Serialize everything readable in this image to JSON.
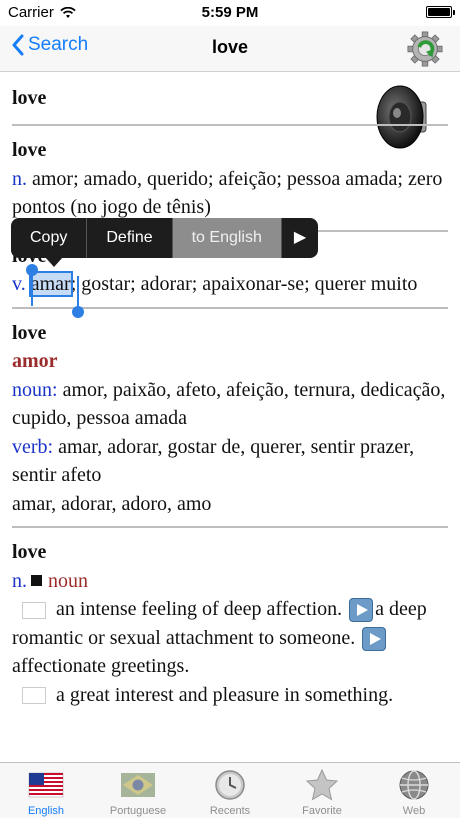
{
  "status": {
    "carrier": "Carrier",
    "time": "5:59 PM"
  },
  "nav": {
    "back_label": "Search",
    "title": "love"
  },
  "entry1": {
    "headword": "love"
  },
  "entry2": {
    "headword": "love",
    "pos": "n.",
    "text": " amor; amado, querido; afeição; pessoa amada; zero pontos (no jogo de tênis)"
  },
  "entry3": {
    "headword": "love",
    "pos": "v.",
    "selected": "amar",
    "text": "; gostar; adorar; apaixonar-se; querer muito"
  },
  "entry4": {
    "headword": "love",
    "translation": "amor",
    "noun_label": "noun:",
    "noun_text": " amor, paixão, afeto, afeição, ternura, dedicação, cupido, pessoa amada",
    "verb_label": "verb:",
    "verb_text": " amar, adorar, gostar de, querer, sentir prazer, sentir afeto",
    "extra": "amar, adorar, adoro, amo"
  },
  "entry5": {
    "headword": "love",
    "pos": "n.",
    "pos_pt": "noun",
    "def1a": "an intense feeling of deep affection.",
    "def1b": "a deep romantic or sexual attachment to someone.",
    "def1c": "affectionate greetings.",
    "def2": "a great interest and pleasure in something."
  },
  "edit_menu": {
    "copy": "Copy",
    "define": "Define",
    "to_english": "to English",
    "more": "▶"
  },
  "tabs": [
    {
      "label": "English",
      "icon": "us-flag-icon",
      "active": true
    },
    {
      "label": "Portuguese",
      "icon": "brazil-flag-icon",
      "active": false
    },
    {
      "label": "Recents",
      "icon": "clock-icon",
      "active": false
    },
    {
      "label": "Favorite",
      "icon": "star-icon",
      "active": false
    },
    {
      "label": "Web",
      "icon": "globe-icon",
      "active": false
    }
  ],
  "colors": {
    "accent": "#157efb",
    "pos_blue": "#1a33c8",
    "pt_red": "#9b2c2c"
  }
}
